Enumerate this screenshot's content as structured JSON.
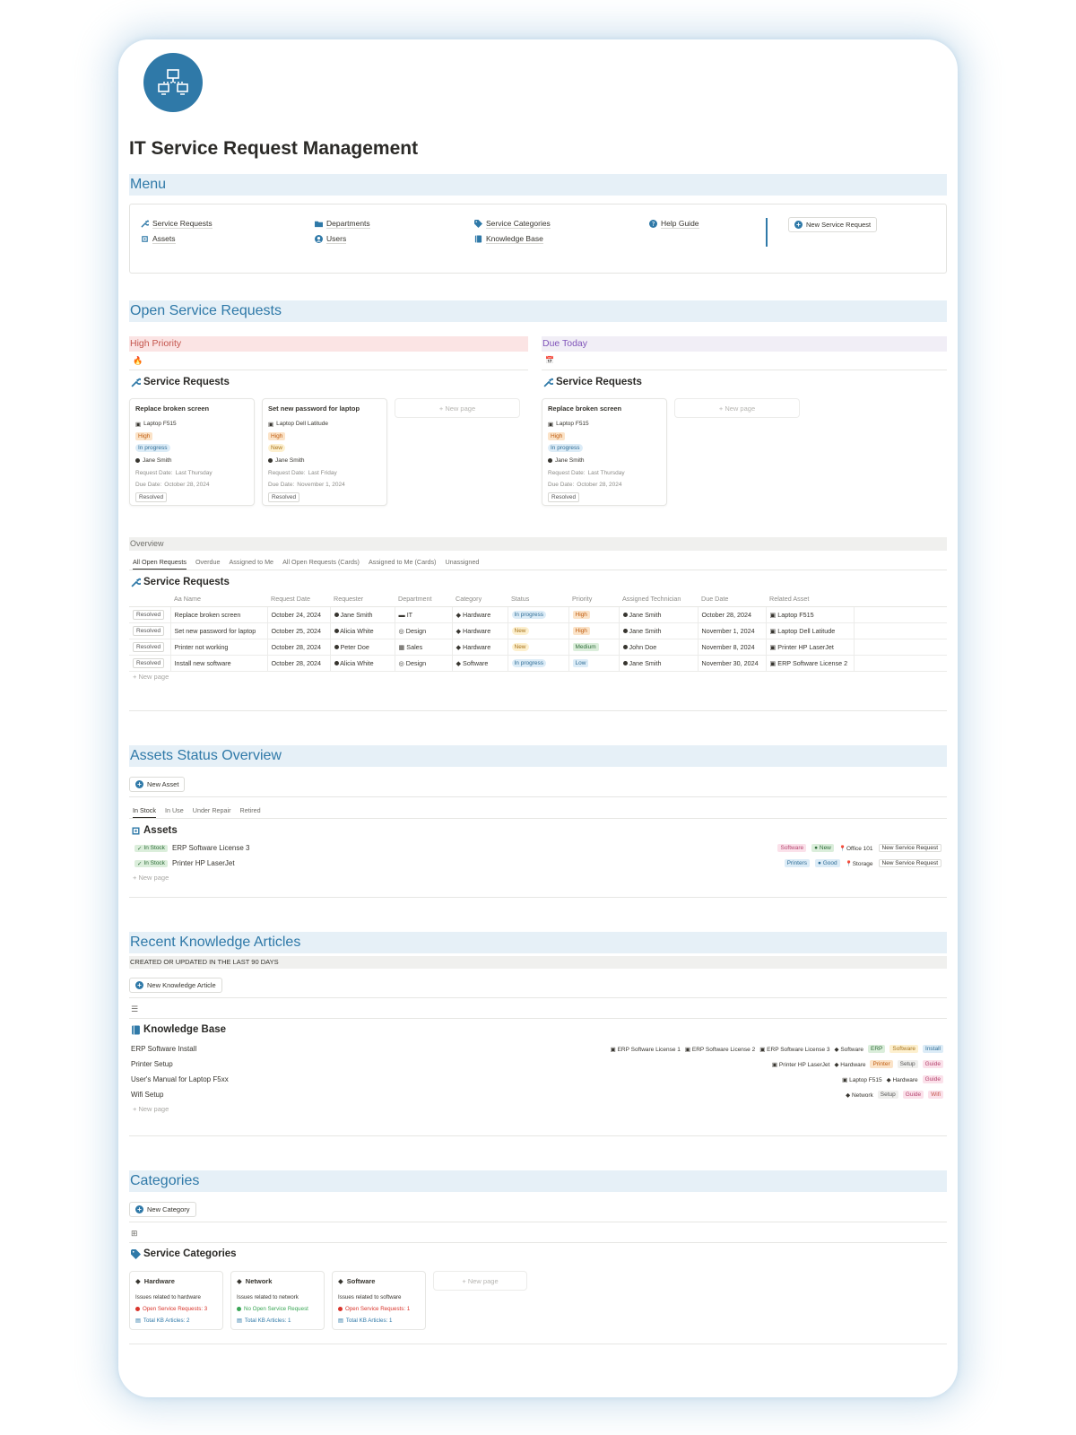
{
  "page": {
    "title": "IT Service Request Management",
    "logo_icon": "network-icon"
  },
  "menu": {
    "title": "Menu",
    "items": [
      {
        "label": "Service Requests",
        "icon": "wrench-icon"
      },
      {
        "label": "Assets",
        "icon": "chip-icon"
      },
      {
        "label": "Departments",
        "icon": "folder-icon"
      },
      {
        "label": "Users",
        "icon": "user-icon"
      },
      {
        "label": "Service Categories",
        "icon": "tag-icon"
      },
      {
        "label": "Knowledge Base",
        "icon": "book-icon"
      },
      {
        "label": "Help Guide",
        "icon": "question-icon"
      }
    ],
    "new_request_button": "New Service Request"
  },
  "open_requests": {
    "title": "Open Service Requests",
    "high_priority": {
      "label": "High Priority",
      "db_title": "Service Requests",
      "cards": [
        {
          "name": "Replace broken screen",
          "asset": "Laptop F515",
          "priority": "High",
          "status": "In progress",
          "technician": "Jane Smith",
          "request_date_label": "Request Date:",
          "request_date": "Last Thursday",
          "due_date_label": "Due Date:",
          "due_date": "October 28, 2024",
          "resolved": "Resolved"
        },
        {
          "name": "Set new password for laptop",
          "asset": "Laptop Dell Latitude",
          "priority": "High",
          "status": "New",
          "technician": "Jane Smith",
          "request_date_label": "Request Date:",
          "request_date": "Last Friday",
          "due_date_label": "Due Date:",
          "due_date": "November 1, 2024",
          "resolved": "Resolved"
        }
      ],
      "new_page": "+ New page"
    },
    "due_today": {
      "label": "Due Today",
      "db_title": "Service Requests",
      "cards": [
        {
          "name": "Replace broken screen",
          "asset": "Laptop F515",
          "priority": "High",
          "status": "In progress",
          "technician": "Jane Smith",
          "request_date_label": "Request Date:",
          "request_date": "Last Thursday",
          "due_date_label": "Due Date:",
          "due_date": "October 28, 2024",
          "resolved": "Resolved"
        }
      ],
      "new_page": "+ New page"
    }
  },
  "overview": {
    "label": "Overview",
    "tabs": [
      "All Open Requests",
      "Overdue",
      "Assigned to Me",
      "All Open Requests (Cards)",
      "Assigned to Me (Cards)",
      "Unassigned"
    ],
    "db_title": "Service Requests",
    "columns": [
      "Aa Name",
      "Request Date",
      "Requester",
      "Department",
      "Category",
      "Status",
      "Priority",
      "Assigned Technician",
      "Due Date",
      "Related Asset"
    ],
    "rows": [
      {
        "resolved": "Resolved",
        "name": "Replace broken screen",
        "request_date": "October 24, 2024",
        "requester": "Jane Smith",
        "department": "IT",
        "category": "Hardware",
        "status": "In progress",
        "priority": "High",
        "technician": "Jane Smith",
        "due": "October 28, 2024",
        "asset": "Laptop F515"
      },
      {
        "resolved": "Resolved",
        "name": "Set new password for laptop",
        "request_date": "October 25, 2024",
        "requester": "Alicia White",
        "department": "Design",
        "category": "Hardware",
        "status": "New",
        "priority": "High",
        "technician": "Jane Smith",
        "due": "November 1, 2024",
        "asset": "Laptop Dell Latitude"
      },
      {
        "resolved": "Resolved",
        "name": "Printer not working",
        "request_date": "October 28, 2024",
        "requester": "Peter Doe",
        "department": "Sales",
        "category": "Hardware",
        "status": "New",
        "priority": "Medium",
        "technician": "John Doe",
        "due": "November 8, 2024",
        "asset": "Printer HP LaserJet"
      },
      {
        "resolved": "Resolved",
        "name": "Install new software",
        "request_date": "October 28, 2024",
        "requester": "Alicia White",
        "department": "Design",
        "category": "Software",
        "status": "In progress",
        "priority": "Low",
        "technician": "Jane Smith",
        "due": "November 30, 2024",
        "asset": "ERP Software License 2"
      }
    ],
    "new_page": "+ New page"
  },
  "assets": {
    "title": "Assets Status Overview",
    "new_button": "New Asset",
    "tabs": [
      "In Stock",
      "In Use",
      "Under Repair",
      "Retired"
    ],
    "db_title": "Assets",
    "rows": [
      {
        "status": "In Stock",
        "name": "ERP Software License 3",
        "category": "Software",
        "condition": "New",
        "location": "Office 101",
        "action": "New Service Request"
      },
      {
        "status": "In Stock",
        "name": "Printer HP LaserJet",
        "category": "Printers",
        "condition": "Good",
        "location": "Storage",
        "action": "New Service Request"
      }
    ],
    "new_page": "+ New page"
  },
  "knowledge": {
    "title": "Recent Knowledge Articles",
    "subtitle": "CREATED OR UPDATED IN THE LAST 90 DAYS",
    "new_button": "New Knowledge Article",
    "db_title": "Knowledge Base",
    "rows": [
      {
        "name": "ERP Software Install",
        "assets": [
          "ERP Software License 1",
          "ERP Software License 2",
          "ERP Software License 3"
        ],
        "category": "Software",
        "tags": [
          "ERP",
          "Software",
          "Install"
        ]
      },
      {
        "name": "Printer Setup",
        "assets": [
          "Printer HP LaserJet"
        ],
        "category": "Hardware",
        "tags": [
          "Printer",
          "Setup",
          "Guide"
        ]
      },
      {
        "name": "User's Manual for Laptop F5xx",
        "assets": [
          "Laptop F515"
        ],
        "category": "Hardware",
        "tags": [
          "Guide"
        ]
      },
      {
        "name": "Wifi Setup",
        "assets": [],
        "category": "Network",
        "tags": [
          "Setup",
          "Guide",
          "Wifi"
        ]
      }
    ],
    "new_page": "+ New page"
  },
  "categories": {
    "title": "Categories",
    "new_button": "New Category",
    "db_title": "Service Categories",
    "cards": [
      {
        "name": "Hardware",
        "desc": "Issues related to hardware",
        "open": "Open Service Requests: 3",
        "open_color": "#d9342b",
        "kb": "Total KB Articles: 2"
      },
      {
        "name": "Network",
        "desc": "Issues related to network",
        "open": "No Open Service Request",
        "open_color": "#3aa655",
        "kb": "Total KB Articles: 1"
      },
      {
        "name": "Software",
        "desc": "Issues related to software",
        "open": "Open Service Requests: 1",
        "open_color": "#d9342b",
        "kb": "Total KB Articles: 1"
      }
    ],
    "new_page": "+ New page"
  }
}
